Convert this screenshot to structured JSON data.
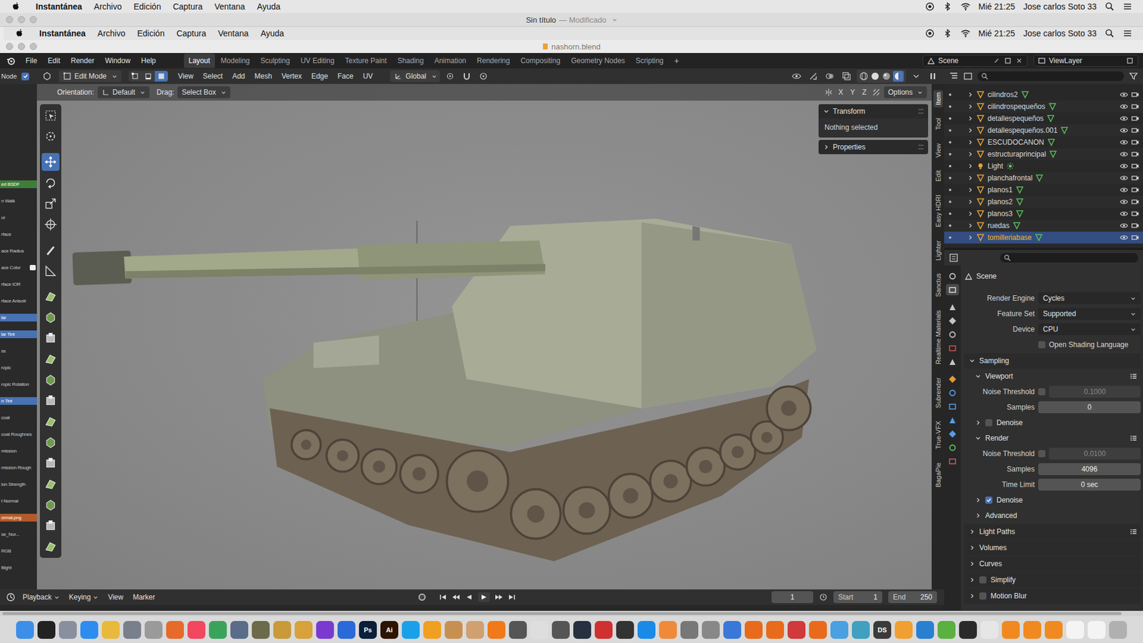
{
  "mac_menubar": {
    "app": "Instantánea",
    "menus": [
      "Archivo",
      "Edición",
      "Captura",
      "Ventana",
      "Ayuda"
    ],
    "clock": "Mié 21:25",
    "user": "Jose carlos Soto 33"
  },
  "screenshot_window": {
    "title": "Sin título",
    "status": "— Modificado"
  },
  "blender_window": {
    "title": "nashorn.blend"
  },
  "topbar": {
    "menus": [
      "File",
      "Edit",
      "Render",
      "Window",
      "Help"
    ],
    "workspaces": [
      {
        "label": "Layout",
        "selected": true
      },
      {
        "label": "Modeling",
        "selected": false
      },
      {
        "label": "Sculpting",
        "selected": false
      },
      {
        "label": "UV Editing",
        "selected": false
      },
      {
        "label": "Texture Paint",
        "selected": false
      },
      {
        "label": "Shading",
        "selected": false
      },
      {
        "label": "Animation",
        "selected": false
      },
      {
        "label": "Rendering",
        "selected": false
      },
      {
        "label": "Compositing",
        "selected": false
      },
      {
        "label": "Geometry Nodes",
        "selected": false
      },
      {
        "label": "Scripting",
        "selected": false
      }
    ],
    "add": "+",
    "scene": "Scene",
    "view_layer": "ViewLayer"
  },
  "header": {
    "side_editor": "Node",
    "mode": "Edit Mode",
    "select_modes": [
      {
        "selected": false
      },
      {
        "selected": false
      },
      {
        "selected": true
      }
    ],
    "menus": [
      "View",
      "Select",
      "Add",
      "Mesh",
      "Vertex",
      "Edge",
      "Face",
      "UV"
    ],
    "orientation": "Global"
  },
  "tool_settings": {
    "orientation_label": "Orientation:",
    "orientation": "Default",
    "drag_label": "Drag:",
    "drag": "Select Box",
    "axes": [
      "X",
      "Y",
      "Z"
    ],
    "options": "Options"
  },
  "left_panel": {
    "items": [
      {
        "text": "ed BSDF",
        "color": "#3f7d3a"
      },
      {
        "text": "n Walk"
      },
      {
        "text": "or"
      },
      {
        "text": "rface"
      },
      {
        "text": "ace Radius"
      },
      {
        "text": "ace Color",
        "swatch": "#eeeeee"
      },
      {
        "text": "rface IOR"
      },
      {
        "text": "rface Anisotr"
      },
      {
        "text": "lar",
        "color": "#4772b3"
      },
      {
        "text": "lar Tint",
        "color": "#4772b3"
      },
      {
        "text": "ss"
      },
      {
        "text": "ropic"
      },
      {
        "text": "ropic Rotation"
      },
      {
        "text": "n Tint",
        "color": "#4772b3"
      },
      {
        "text": "coat"
      },
      {
        "text": "coat Roughnes"
      },
      {
        "text": "mission"
      },
      {
        "text": "mission Rough"
      },
      {
        "text": "ion Strength"
      },
      {
        "text": "t Normal"
      },
      {
        "text": "ormal.png",
        "color": "#b35a2a"
      },
      {
        "text": "se_Nor..."
      },
      {
        "text": "RGB"
      },
      {
        "text": "itlight"
      }
    ]
  },
  "toolbar": {
    "tools": [
      {
        "selected": false
      },
      {
        "selected": false
      },
      {
        "selected": true
      },
      {
        "selected": false
      },
      {
        "selected": false
      },
      {
        "selected": false
      },
      {
        "selected": false
      },
      {
        "selected": false
      },
      {
        "selected": false
      },
      {
        "selected": false
      },
      {
        "selected": false
      },
      {
        "selected": false
      },
      {
        "selected": false
      },
      {
        "selected": false
      },
      {
        "selected": false
      },
      {
        "selected": false
      },
      {
        "selected": false
      },
      {
        "selected": false
      },
      {
        "selected": false
      },
      {
        "selected": false
      },
      {
        "selected": false
      }
    ]
  },
  "n_panel": {
    "sections": [
      {
        "title": "Transform",
        "expanded": true,
        "text": "Nothing selected"
      },
      {
        "title": "Properties",
        "expanded": false
      }
    ]
  },
  "side_tabs": [
    {
      "label": "Item",
      "selected": true
    },
    {
      "label": "Tool",
      "selected": false
    },
    {
      "label": "View",
      "selected": false
    },
    {
      "label": "Edit",
      "selected": false
    },
    {
      "label": "Easy HDRI",
      "selected": false
    },
    {
      "label": "Lighter",
      "selected": false
    },
    {
      "label": "Sanctus",
      "selected": false
    },
    {
      "label": "Realtime Materials",
      "selected": false
    },
    {
      "label": "Subrender",
      "selected": false
    },
    {
      "label": "True-VFX",
      "selected": false
    },
    {
      "label": "BagaPie",
      "selected": false
    }
  ],
  "outliner": {
    "items": [
      {
        "name": "cilindros2",
        "kind": "mesh",
        "selected": false
      },
      {
        "name": "cilindrospequeños",
        "kind": "mesh",
        "selected": false
      },
      {
        "name": "detallespequeños",
        "kind": "mesh",
        "selected": false
      },
      {
        "name": "detallespequeños.001",
        "kind": "mesh",
        "selected": false
      },
      {
        "name": "ESCUDOCANON",
        "kind": "mesh",
        "selected": false
      },
      {
        "name": "estructuraprincipal",
        "kind": "mesh",
        "selected": false
      },
      {
        "name": "Light",
        "kind": "light",
        "selected": false
      },
      {
        "name": "planchafrontal",
        "kind": "mesh",
        "selected": false
      },
      {
        "name": "planos1",
        "kind": "mesh",
        "selected": false
      },
      {
        "name": "planos2",
        "kind": "mesh",
        "selected": false
      },
      {
        "name": "planos3",
        "kind": "mesh",
        "selected": false
      },
      {
        "name": "ruedas",
        "kind": "mesh",
        "selected": false
      },
      {
        "name": "tomilleriabase",
        "kind": "mesh",
        "selected": true
      }
    ]
  },
  "properties": {
    "context": "Scene",
    "tabs": [
      {
        "color": "#c4c4c4",
        "selected": false
      },
      {
        "color": "#d6d6d6",
        "selected": true
      },
      {
        "color": "#c4c4c4",
        "selected": false
      },
      {
        "color": "#c4c4c4",
        "selected": false
      },
      {
        "color": "#c4c4c4",
        "selected": false
      },
      {
        "color": "#d05050",
        "selected": false
      },
      {
        "color": "#c4c4c4",
        "selected": false
      },
      {
        "color": "#e39a3a",
        "selected": false
      },
      {
        "color": "#5a9ae8",
        "selected": false
      },
      {
        "color": "#5a9ae8",
        "selected": false
      },
      {
        "color": "#5a9ae8",
        "selected": false
      },
      {
        "color": "#5a9ae8",
        "selected": false
      },
      {
        "color": "#5cc05c",
        "selected": false
      },
      {
        "color": "#d05a5a",
        "selected": false
      }
    ],
    "rows": [
      {
        "kind": "dropdown",
        "label": "Render Engine",
        "value": "Cycles"
      },
      {
        "kind": "dropdown",
        "label": "Feature Set",
        "value": "Supported"
      },
      {
        "kind": "dropdown",
        "label": "Device",
        "value": "CPU"
      },
      {
        "kind": "checkbox",
        "label": "Open Shading Language",
        "checked": false
      },
      {
        "kind": "panel",
        "label": "Sampling",
        "expanded": true
      },
      {
        "kind": "subpanel",
        "label": "Viewport",
        "expanded": true,
        "presets": true
      },
      {
        "kind": "number",
        "label": "Noise Threshold",
        "value": "0.1000",
        "checked": false,
        "enabled": false
      },
      {
        "kind": "number",
        "label": "Samples",
        "value": "0"
      },
      {
        "kind": "subcheck",
        "label": "Denoise",
        "expanded": false,
        "checked": false
      },
      {
        "kind": "subpanel",
        "label": "Render",
        "expanded": true,
        "presets": true
      },
      {
        "kind": "number",
        "label": "Noise Threshold",
        "value": "0.0100",
        "checked": false,
        "enabled": false
      },
      {
        "kind": "number",
        "label": "Samples",
        "value": "4096"
      },
      {
        "kind": "number",
        "label": "Time Limit",
        "value": "0 sec"
      },
      {
        "kind": "subcheck",
        "label": "Denoise",
        "expanded": false,
        "checked": true
      },
      {
        "kind": "subpanel",
        "label": "Advanced",
        "expanded": false
      },
      {
        "kind": "panel",
        "label": "Light Paths",
        "expanded": false,
        "presets": true
      },
      {
        "kind": "panel",
        "label": "Volumes",
        "expanded": false
      },
      {
        "kind": "panel",
        "label": "Curves",
        "expanded": false
      },
      {
        "kind": "panelcheck",
        "label": "Simplify",
        "expanded": false,
        "checked": false
      },
      {
        "kind": "panelcheck",
        "label": "Motion Blur",
        "expanded": false,
        "checked": false
      }
    ]
  },
  "timeline": {
    "menus": [
      "Playback",
      "Keying",
      "View",
      "Marker"
    ],
    "frame": "1",
    "start_label": "Start",
    "start": "1",
    "end_label": "End",
    "end": "250"
  },
  "dock": {
    "apps": [
      {
        "color": "#3b8fe8",
        "label": ""
      },
      {
        "color": "#222222",
        "label": ""
      },
      {
        "color": "#8a8fa0",
        "label": ""
      },
      {
        "color": "#2d8cf0",
        "label": ""
      },
      {
        "color": "#e8b93a",
        "label": ""
      },
      {
        "color": "#7a7f8c",
        "label": ""
      },
      {
        "color": "#9a9a9a",
        "label": ""
      },
      {
        "color": "#e66b2a",
        "label": ""
      },
      {
        "color": "#f2475f",
        "label": ""
      },
      {
        "color": "#3aa35b",
        "label": ""
      },
      {
        "color": "#5b6b8a",
        "label": ""
      },
      {
        "color": "#6b6a4a",
        "label": ""
      },
      {
        "color": "#c89a3a",
        "label": ""
      },
      {
        "color": "#d8a23a",
        "label": ""
      },
      {
        "color": "#7a3ad0",
        "label": ""
      },
      {
        "color": "#2a6ad8",
        "label": ""
      },
      {
        "color": "#0b1e3a",
        "label": "Ps"
      },
      {
        "color": "#2b1400",
        "label": "Ai"
      },
      {
        "color": "#1aa0e8",
        "label": ""
      },
      {
        "color": "#f0a020",
        "label": ""
      },
      {
        "color": "#c89050",
        "label": ""
      },
      {
        "color": "#d0a070",
        "label": ""
      },
      {
        "color": "#f07a1a",
        "label": ""
      },
      {
        "color": "#555555",
        "label": ""
      },
      {
        "color": "#dedede",
        "label": ""
      },
      {
        "color": "#555555",
        "label": ""
      },
      {
        "color": "#263040",
        "label": ""
      },
      {
        "color": "#d03030",
        "label": ""
      },
      {
        "color": "#333333",
        "label": ""
      },
      {
        "color": "#1a8ae8",
        "label": ""
      },
      {
        "color": "#ef8a3a",
        "label": ""
      },
      {
        "color": "#777777",
        "label": ""
      },
      {
        "color": "#888888",
        "label": ""
      },
      {
        "color": "#3a78d8",
        "label": ""
      },
      {
        "color": "#e86a1a",
        "label": ""
      },
      {
        "color": "#e86a1a",
        "label": ""
      },
      {
        "color": "#d03a3a",
        "label": ""
      },
      {
        "color": "#e86a1a",
        "label": ""
      },
      {
        "color": "#4aa0e0",
        "label": ""
      },
      {
        "color": "#40a0c0",
        "label": ""
      },
      {
        "color": "#3a3a3a",
        "label": "DS"
      },
      {
        "color": "#f0a030",
        "label": ""
      },
      {
        "color": "#2a80d0",
        "label": ""
      },
      {
        "color": "#5ab040",
        "label": ""
      },
      {
        "color": "#2a2a2a",
        "label": ""
      },
      {
        "color": "#e6e6e6",
        "label": ""
      },
      {
        "color": "#f08a20",
        "label": ""
      },
      {
        "color": "#f08a20",
        "label": ""
      },
      {
        "color": "#f08a20",
        "label": ""
      },
      {
        "color": "#f4f4f4",
        "label": ""
      },
      {
        "color": "#f4f4f4",
        "label": ""
      },
      {
        "color": "#b0b0b0",
        "label": ""
      }
    ]
  }
}
